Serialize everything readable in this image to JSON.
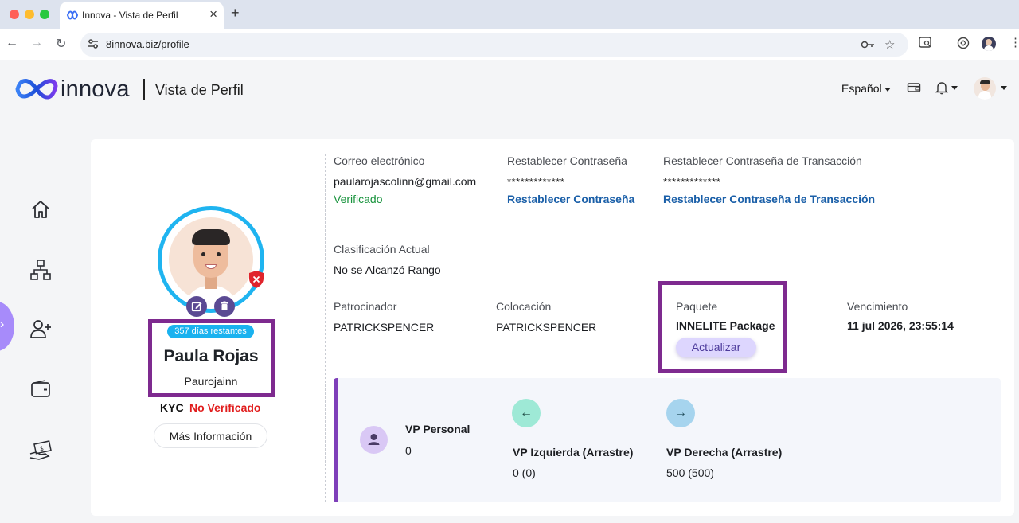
{
  "browser": {
    "tab_title": "Innova - Vista de Perfil",
    "url": "8innova.biz/profile"
  },
  "header": {
    "brand": "innova",
    "page_title": "Vista de Perfil",
    "language": "Español"
  },
  "profile": {
    "days_remaining": "357 días restantes",
    "name": "Paula Rojas",
    "username": "Paurojainn",
    "kyc_label": "KYC",
    "kyc_status": "No Verificado",
    "more_info_label": "Más Información"
  },
  "account": {
    "email_label": "Correo electrónico",
    "email": "paularojascolinn@gmail.com",
    "email_status": "Verificado",
    "password_label": "Restablecer Contraseña",
    "password_masked": "*************",
    "password_link": "Restablecer Contraseña",
    "tx_password_label": "Restablecer Contraseña de Transacción",
    "tx_password_masked": "*************",
    "tx_password_link": "Restablecer Contraseña de Transacción",
    "rank_label": "Clasificación Actual",
    "rank_value": "No se Alcanzó Rango",
    "sponsor_label": "Patrocinador",
    "sponsor_value": "PATRICKSPENCER",
    "placement_label": "Colocación",
    "placement_value": "PATRICKSPENCER",
    "package_label": "Paquete",
    "package_value": "INNELITE Package",
    "upgrade_label": "Actualizar",
    "expiry_label": "Vencimiento",
    "expiry_value": "11 jul 2026, 23:55:14"
  },
  "vp": {
    "personal_label": "VP Personal",
    "personal_value": "0",
    "left_label": "VP Izquierda (Arrastre)",
    "left_value": "0 (0)",
    "right_label": "VP Derecha (Arrastre)",
    "right_value": "500 (500)"
  },
  "colors": {
    "highlight": "#7e2a8f",
    "ring": "#1fb4f0",
    "link": "#1a5fa8",
    "verified": "#17933c",
    "unverified": "#e11d1d",
    "vp_accent": "#7e3fb9"
  },
  "icons": {
    "sidebar": [
      "home-icon",
      "network-tree-icon",
      "add-user-icon",
      "wallet-icon",
      "money-hand-icon"
    ],
    "header": [
      "wallet-card-icon",
      "bell-icon"
    ]
  }
}
